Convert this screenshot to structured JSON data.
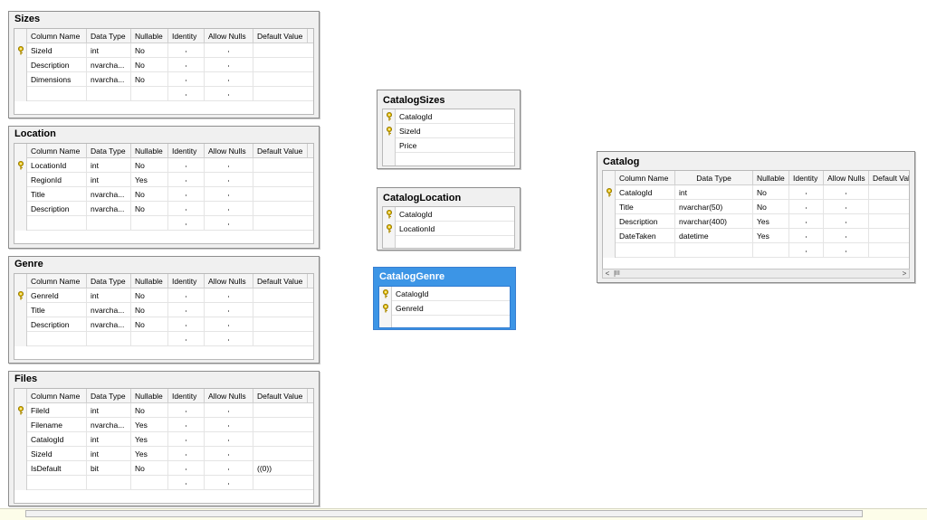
{
  "columns": [
    "Column Name",
    "Data Type",
    "Nullable",
    "Identity",
    "Allow Nulls",
    "Default Value"
  ],
  "sizes": {
    "title": "Sizes",
    "rows": [
      {
        "name": "SizeId",
        "type": "int",
        "nullable": "No",
        "key": true
      },
      {
        "name": "Description",
        "type": "nvarcha...",
        "nullable": "No",
        "key": false
      },
      {
        "name": "Dimensions",
        "type": "nvarcha...",
        "nullable": "No",
        "key": false
      }
    ]
  },
  "location": {
    "title": "Location",
    "rows": [
      {
        "name": "LocationId",
        "type": "int",
        "nullable": "No",
        "key": true
      },
      {
        "name": "RegionId",
        "type": "int",
        "nullable": "Yes",
        "key": false
      },
      {
        "name": "Title",
        "type": "nvarcha...",
        "nullable": "No",
        "key": false
      },
      {
        "name": "Description",
        "type": "nvarcha...",
        "nullable": "No",
        "key": false
      }
    ]
  },
  "genre": {
    "title": "Genre",
    "rows": [
      {
        "name": "GenreId",
        "type": "int",
        "nullable": "No",
        "key": true
      },
      {
        "name": "Title",
        "type": "nvarcha...",
        "nullable": "No",
        "key": false
      },
      {
        "name": "Description",
        "type": "nvarcha...",
        "nullable": "No",
        "key": false
      }
    ]
  },
  "files": {
    "title": "Files",
    "rows": [
      {
        "name": "FileId",
        "type": "int",
        "nullable": "No",
        "key": true
      },
      {
        "name": "Filename",
        "type": "nvarcha...",
        "nullable": "Yes",
        "key": false
      },
      {
        "name": "CatalogId",
        "type": "int",
        "nullable": "Yes",
        "key": false
      },
      {
        "name": "SizeId",
        "type": "int",
        "nullable": "Yes",
        "key": false
      },
      {
        "name": "IsDefault",
        "type": "bit",
        "nullable": "No",
        "key": false,
        "default": "((0))"
      }
    ]
  },
  "catalog_sizes": {
    "title": "CatalogSizes",
    "rows": [
      {
        "name": "CatalogId",
        "key": true
      },
      {
        "name": "SizeId",
        "key": true
      },
      {
        "name": "Price",
        "key": false
      }
    ]
  },
  "catalog_location": {
    "title": "CatalogLocation",
    "rows": [
      {
        "name": "CatalogId",
        "key": true
      },
      {
        "name": "LocationId",
        "key": true
      }
    ]
  },
  "catalog_genre": {
    "title": "CatalogGenre",
    "rows": [
      {
        "name": "CatalogId",
        "key": true
      },
      {
        "name": "GenreId",
        "key": true
      }
    ]
  },
  "catalog": {
    "title": "Catalog",
    "columns": [
      "Column Name",
      "Data Type",
      "Nullable",
      "Identity",
      "Allow Nulls",
      "Default Val"
    ],
    "rows": [
      {
        "name": "CatalogId",
        "type": "int",
        "nullable": "No",
        "key": true
      },
      {
        "name": "Title",
        "type": "nvarchar(50)",
        "nullable": "No",
        "key": false
      },
      {
        "name": "Description",
        "type": "nvarchar(400)",
        "nullable": "Yes",
        "key": false
      },
      {
        "name": "DateTaken",
        "type": "datetime",
        "nullable": "Yes",
        "key": false
      }
    ],
    "scroll_left": "<",
    "scroll_right": ">",
    "scroll_thumb": "III"
  },
  "colors": {
    "selected_table": "#3c95e6",
    "key_icon": "#d8b000"
  }
}
